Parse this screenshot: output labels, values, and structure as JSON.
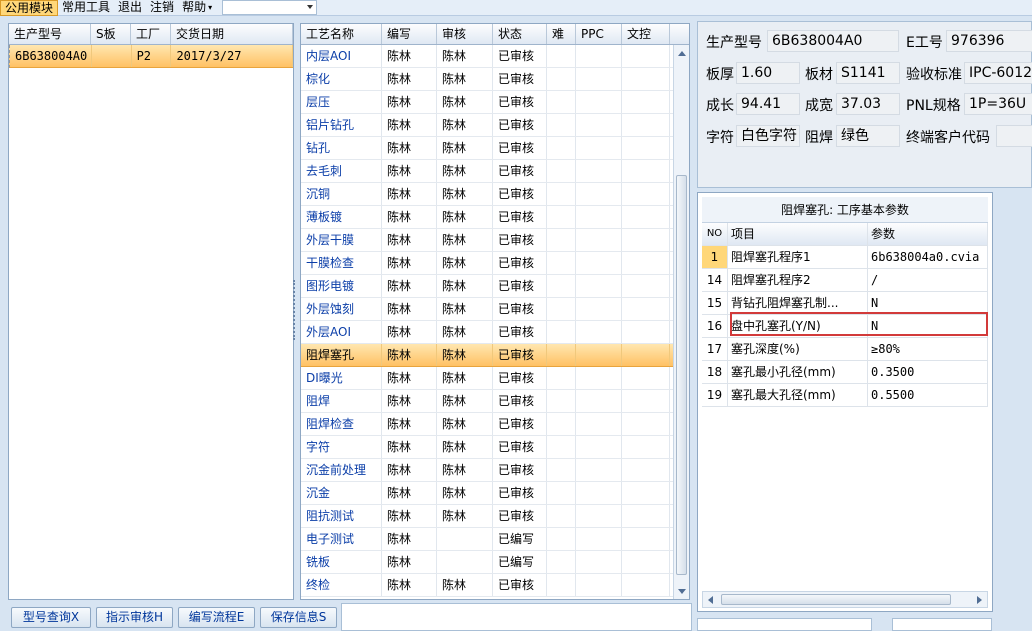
{
  "menu": {
    "items": [
      "公用模块",
      "常用工具",
      "退出",
      "注销",
      "帮助"
    ],
    "dropdown_value": ""
  },
  "left_grid": {
    "headers": [
      "生产型号",
      "S板",
      "工厂",
      "交货日期"
    ],
    "rows": [
      [
        "6B638004A0",
        "",
        "P2",
        "2017/3/27"
      ]
    ]
  },
  "process_grid": {
    "headers": [
      "工艺名称",
      "编写",
      "审核",
      "状态",
      "难",
      "PPC",
      "文控"
    ],
    "rows": [
      [
        "内层AOI",
        "陈林",
        "陈林",
        "已审核"
      ],
      [
        "棕化",
        "陈林",
        "陈林",
        "已审核"
      ],
      [
        "层压",
        "陈林",
        "陈林",
        "已审核"
      ],
      [
        "铝片钻孔",
        "陈林",
        "陈林",
        "已审核"
      ],
      [
        "钻孔",
        "陈林",
        "陈林",
        "已审核"
      ],
      [
        "去毛刺",
        "陈林",
        "陈林",
        "已审核"
      ],
      [
        "沉铜",
        "陈林",
        "陈林",
        "已审核"
      ],
      [
        "薄板镀",
        "陈林",
        "陈林",
        "已审核"
      ],
      [
        "外层干膜",
        "陈林",
        "陈林",
        "已审核"
      ],
      [
        "干膜检查",
        "陈林",
        "陈林",
        "已审核"
      ],
      [
        "图形电镀",
        "陈林",
        "陈林",
        "已审核"
      ],
      [
        "外层蚀刻",
        "陈林",
        "陈林",
        "已审核"
      ],
      [
        "外层AOI",
        "陈林",
        "陈林",
        "已审核"
      ],
      [
        "阻焊塞孔",
        "陈林",
        "陈林",
        "已审核"
      ],
      [
        "DI曝光",
        "陈林",
        "陈林",
        "已审核"
      ],
      [
        "阻焊",
        "陈林",
        "陈林",
        "已审核"
      ],
      [
        "阻焊检查",
        "陈林",
        "陈林",
        "已审核"
      ],
      [
        "字符",
        "陈林",
        "陈林",
        "已审核"
      ],
      [
        "沉金前处理",
        "陈林",
        "陈林",
        "已审核"
      ],
      [
        "沉金",
        "陈林",
        "陈林",
        "已审核"
      ],
      [
        "阻抗测试",
        "陈林",
        "陈林",
        "已审核"
      ],
      [
        "电子测试",
        "陈林",
        "",
        "已编写"
      ],
      [
        "铣板",
        "陈林",
        "",
        "已编写"
      ],
      [
        "终检",
        "陈林",
        "陈林",
        "已审核"
      ]
    ],
    "selected_index": 13
  },
  "buttons": [
    "型号查询X",
    "指示审核H",
    "编写流程E",
    "保存信息S"
  ],
  "info": {
    "model_label": "生产型号",
    "model_value": "6B638004A0",
    "eno_label": "E工号",
    "eno_value": "976396",
    "thickness_label": "板厚",
    "thickness_value": "1.60",
    "material_label": "板材",
    "material_value": "S1141",
    "standard_label": "验收标准",
    "standard_value": "IPC-6012",
    "length_label": "成长",
    "length_value": "94.41",
    "width_label": "成宽",
    "width_value": "37.03",
    "pnl_label": "PNL规格",
    "pnl_value": "1P=36U",
    "char_label": "字符",
    "char_value": "白色字符",
    "mask_label": "阻焊",
    "mask_value": "绿色",
    "customer_label": "终端客户代码",
    "customer_value": ""
  },
  "params": {
    "title": "阻焊塞孔: 工序基本参数",
    "headers": [
      "NO",
      "项目",
      "参数"
    ],
    "rows": [
      [
        "1",
        "阻焊塞孔程序1",
        "6b638004a0.cvia"
      ],
      [
        "14",
        "阻焊塞孔程序2",
        "/"
      ],
      [
        "15",
        "背钻孔阻焊塞孔制...",
        "N"
      ],
      [
        "16",
        "盘中孔塞孔(Y/N)",
        "N"
      ],
      [
        "17",
        "塞孔深度(%)",
        "≥80%"
      ],
      [
        "18",
        "塞孔最小孔径(mm)",
        "0.3500"
      ],
      [
        "19",
        "塞孔最大孔径(mm)",
        "0.5500"
      ]
    ]
  }
}
